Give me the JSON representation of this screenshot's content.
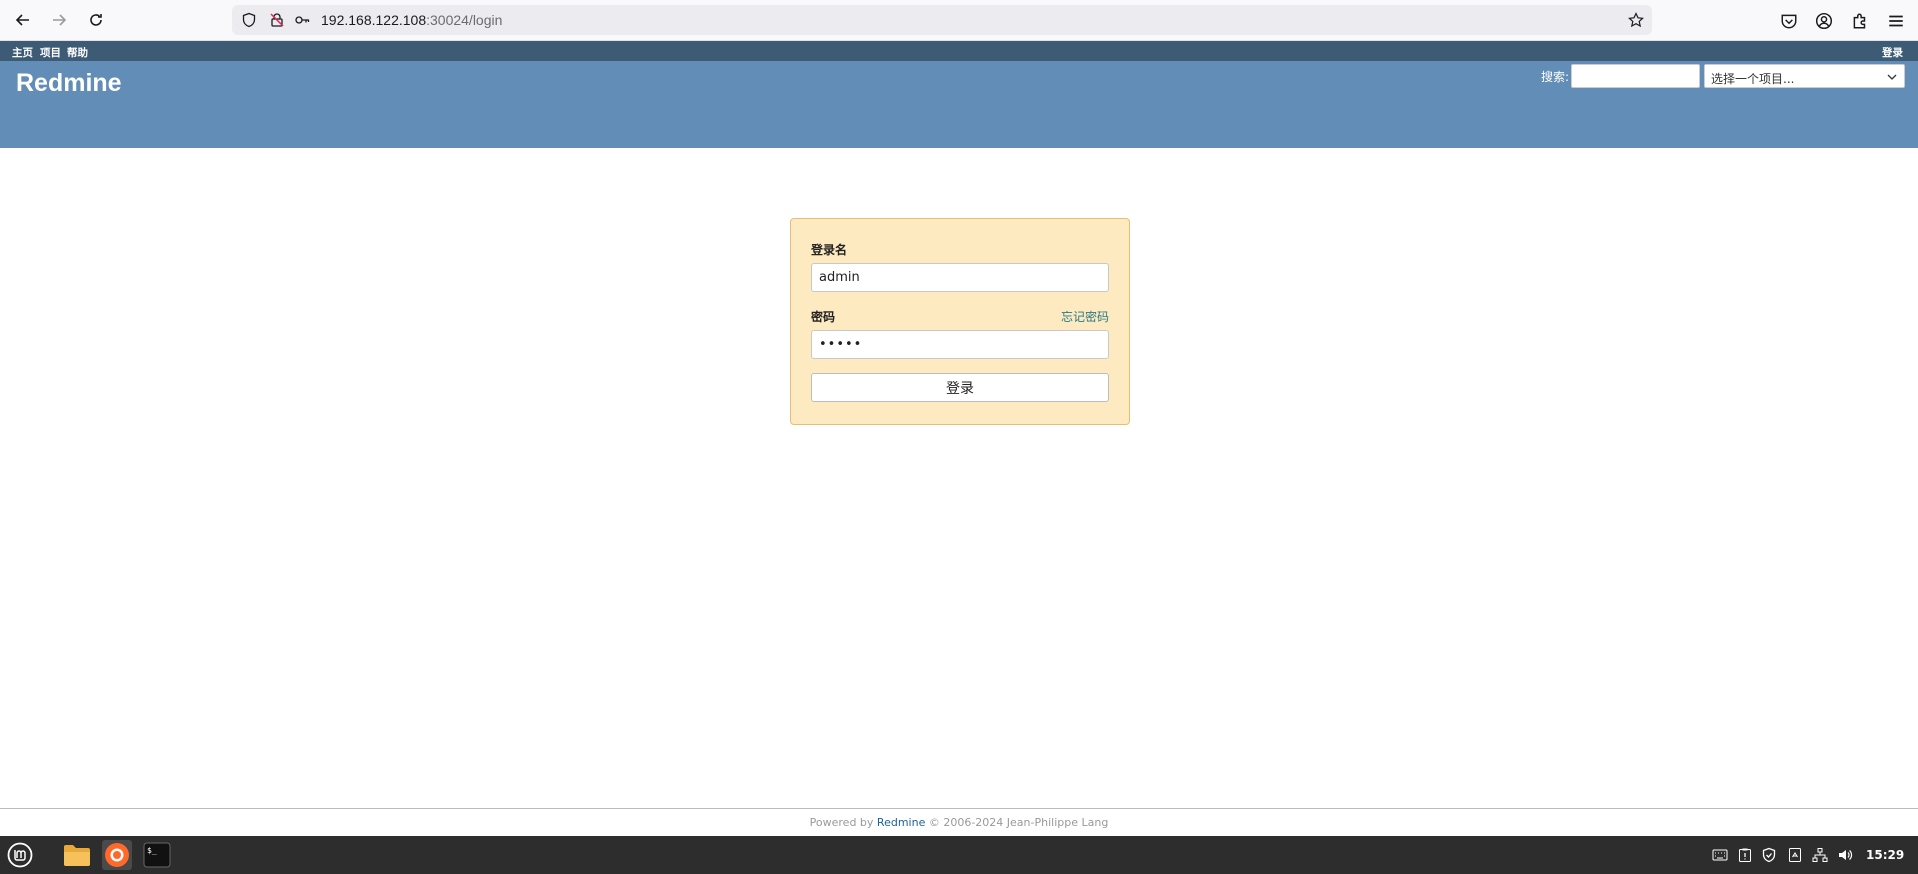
{
  "browser": {
    "url_host": "192.168.122.108",
    "url_path": ":30024/login"
  },
  "top_menu": {
    "items": [
      "主页",
      "项目",
      "帮助"
    ],
    "login_link": "登录"
  },
  "header": {
    "title": "Redmine",
    "search_label": "搜索:",
    "search_value": "",
    "project_select": "选择一个项目..."
  },
  "login_form": {
    "username_label": "登录名",
    "username_value": "admin",
    "password_label": "密码",
    "password_value": "•••••",
    "forgot_password": "忘记密码",
    "submit_label": "登录"
  },
  "footer": {
    "powered_by": "Powered by",
    "app_link": "Redmine",
    "copyright": "© 2006-2024 Jean-Philippe Lang"
  },
  "taskbar": {
    "clock": "15:29"
  },
  "colors": {
    "top_menu_bg": "#3e5b76",
    "header_bg": "#628db6",
    "login_box_bg": "#fdeac1",
    "login_box_border": "#e4c073",
    "link": "#2a7a85",
    "taskbar_bg": "#2d2d2d"
  }
}
